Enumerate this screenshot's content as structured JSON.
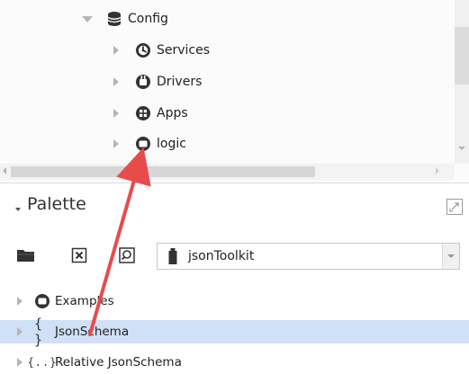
{
  "nav_tree": {
    "items": [
      {
        "label": "Config",
        "expanded": true,
        "icon": "database-icon"
      },
      {
        "label": "Services",
        "icon": "services-icon"
      },
      {
        "label": "Drivers",
        "icon": "drivers-icon"
      },
      {
        "label": "Apps",
        "icon": "apps-icon"
      },
      {
        "label": "logic",
        "icon": "folder-icon"
      }
    ]
  },
  "palette": {
    "title": "Palette",
    "module_select": {
      "value": "jsonToolkit"
    },
    "items": [
      {
        "label": "Examples",
        "icon": "folder-icon"
      },
      {
        "label": "JsonSchema",
        "icon": "json-schema-icon",
        "selected": true
      },
      {
        "label": "Relative JsonSchema",
        "icon": "relative-json-schema-icon"
      }
    ]
  },
  "colors": {
    "selection": "#cfe0f7",
    "annotation_arrow": "#e84b4b"
  }
}
